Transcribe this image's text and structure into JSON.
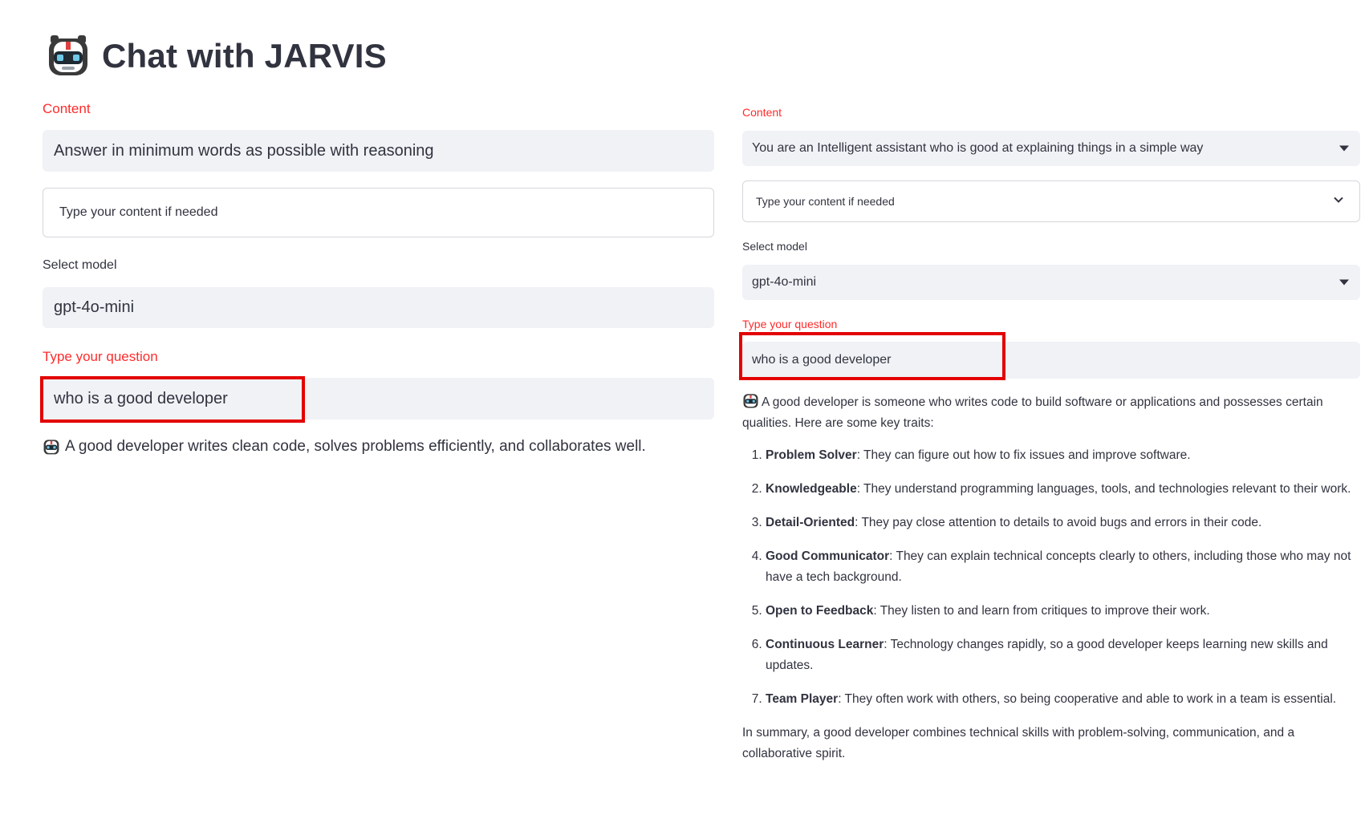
{
  "app": {
    "title": "Chat with JARVIS",
    "icon": "robot-face-icon",
    "accent_color": "#ff2b2b",
    "highlight_color": "#e30000"
  },
  "left": {
    "content_label": "Content",
    "content_value": "Answer in minimum words as possible with reasoning",
    "custom_content_placeholder": "Type your content if needed",
    "model_label": "Select model",
    "model_value": "gpt-4o-mini",
    "question_label": "Type your question",
    "question_value": "who is a good developer",
    "answer": "A good developer writes clean code, solves problems efficiently, and collaborates well."
  },
  "right": {
    "content_label": "Content",
    "content_value": "You are an Intelligent assistant who is good at explaining things in a simple way",
    "custom_content_placeholder": "Type your content if needed",
    "model_label": "Select model",
    "model_value": "gpt-4o-mini",
    "question_label": "Type your question",
    "question_value": "who is a good developer",
    "answer_intro": "A good developer is someone who writes code to build software or applications and possesses certain qualities. Here are some key traits:",
    "traits": [
      {
        "title": "Problem Solver",
        "text": ": They can figure out how to fix issues and improve software."
      },
      {
        "title": "Knowledgeable",
        "text": ": They understand programming languages, tools, and technologies relevant to their work."
      },
      {
        "title": "Detail-Oriented",
        "text": ": They pay close attention to details to avoid bugs and errors in their code."
      },
      {
        "title": "Good Communicator",
        "text": ": They can explain technical concepts clearly to others, including those who may not have a tech background."
      },
      {
        "title": "Open to Feedback",
        "text": ": They listen to and learn from critiques to improve their work."
      },
      {
        "title": "Continuous Learner",
        "text": ": Technology changes rapidly, so a good developer keeps learning new skills and updates."
      },
      {
        "title": "Team Player",
        "text": ": They often work with others, so being cooperative and able to work in a team is essential."
      }
    ],
    "answer_summary": "In summary, a good developer combines technical skills with problem-solving, communication, and a collaborative spirit."
  }
}
